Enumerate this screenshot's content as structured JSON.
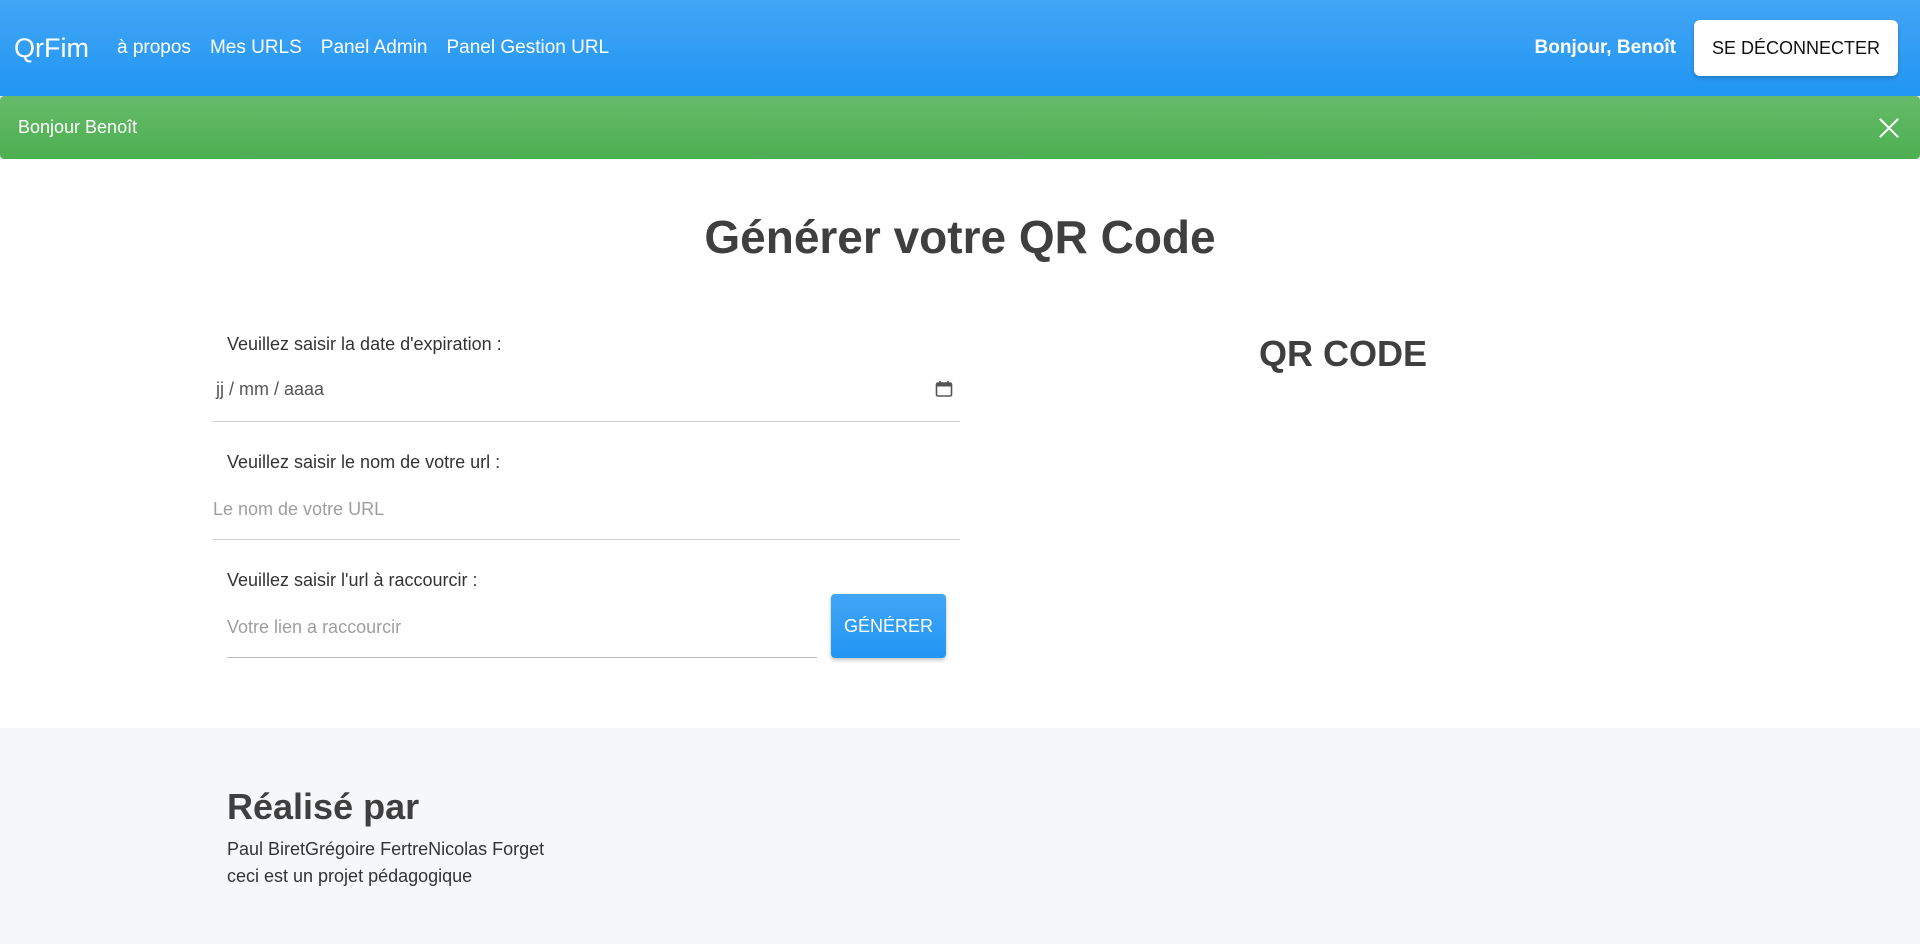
{
  "navbar": {
    "brand": "QrFim",
    "links": [
      "à propos",
      "Mes URLS",
      "Panel Admin",
      "Panel Gestion URL"
    ],
    "greeting": "Bonjour, Benoît",
    "logout_label": "SE DÉCONNECTER",
    "color": "#2196f3"
  },
  "alert": {
    "message": "Bonjour Benoît",
    "color": "#4caf50"
  },
  "main": {
    "title": "Générer votre QR Code",
    "expiration": {
      "label": "Veuillez saisir la date d'expiration :",
      "value": "jj / mm / aaaa",
      "icon": "calendar-icon"
    },
    "url_name": {
      "label": "Veuillez saisir le nom de votre url :",
      "placeholder": "Le nom de votre URL"
    },
    "url_long": {
      "label": "Veuillez saisir l'url à raccourcir :",
      "placeholder": "Votre lien a raccourcir"
    },
    "generate_label": "GÉNÉRER",
    "qr_title": "QR CODE"
  },
  "footer": {
    "title": "Réalisé par",
    "authors": "Paul BiretGrégoire FertreNicolas Forget",
    "note": "ceci est un projet pédagogique"
  }
}
